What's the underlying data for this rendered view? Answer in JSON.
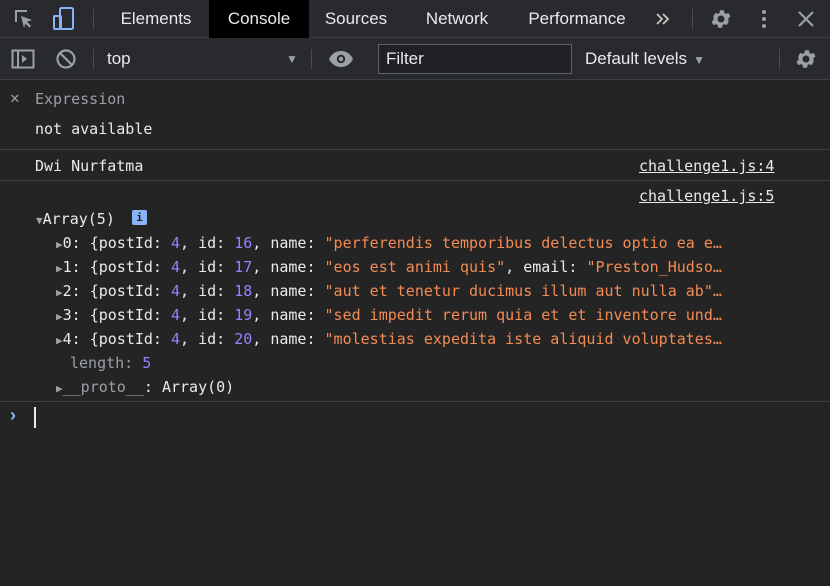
{
  "tabs": [
    "Elements",
    "Console",
    "Sources",
    "Network",
    "Performance"
  ],
  "active_tab": "Console",
  "toolbar": {
    "context": "top",
    "filter_placeholder": "Filter",
    "levels": "Default levels"
  },
  "expression": {
    "label": "Expression",
    "value": "not available"
  },
  "logs": [
    {
      "text": "Dwi Nurfatma",
      "source": "challenge1.js:4"
    },
    {
      "source": "challenge1.js:5"
    }
  ],
  "array": {
    "summary": "Array(5)",
    "items": [
      {
        "index": "0:",
        "postId": "4",
        "id": "16",
        "name": "\"perferendis temporibus delectus optio ea e…"
      },
      {
        "index": "1:",
        "postId": "4",
        "id": "17",
        "name": "\"eos est animi quis\"",
        "email": "\"Preston_Hudso…"
      },
      {
        "index": "2:",
        "postId": "4",
        "id": "18",
        "name": "\"aut et tenetur ducimus illum aut nulla ab\"…"
      },
      {
        "index": "3:",
        "postId": "4",
        "id": "19",
        "name": "\"sed impedit rerum quia et et inventore und…"
      },
      {
        "index": "4:",
        "postId": "4",
        "id": "20",
        "name": "\"molestias expedita iste aliquid voluptates…"
      }
    ],
    "length_label": "length:",
    "length_value": "5",
    "proto_label": "__proto__",
    "proto_value": "Array(0)"
  },
  "colors": {
    "number": "#9980ff",
    "string": "#f28b54",
    "accent": "#8ab4f8"
  }
}
